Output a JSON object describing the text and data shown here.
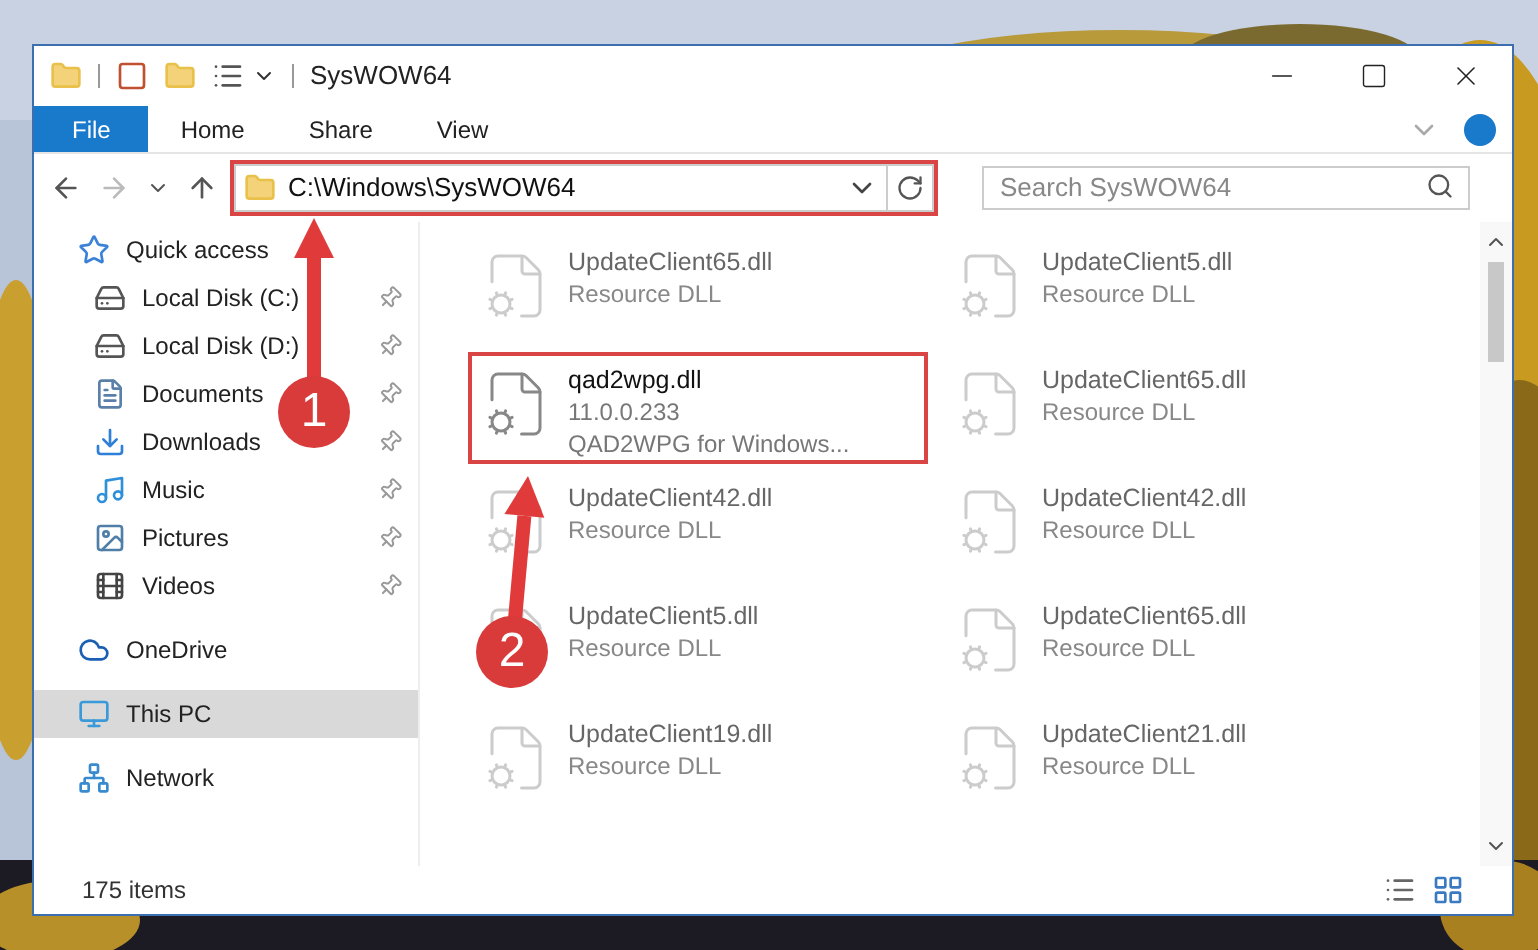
{
  "window": {
    "title": "SysWOW64"
  },
  "ribbon_tabs": [
    {
      "label": "File",
      "kind": "file"
    },
    {
      "label": "Home",
      "kind": "tab"
    },
    {
      "label": "Share",
      "kind": "tab"
    },
    {
      "label": "View",
      "kind": "tab"
    }
  ],
  "address": {
    "path": "C:\\Windows\\SysWOW64"
  },
  "search": {
    "placeholder": "Search SysWOW64"
  },
  "sidebar": {
    "items": [
      {
        "label": "Quick access",
        "selected": false,
        "children": [
          {
            "label": "Local Disk (C:)",
            "pinned": true,
            "selected": false
          },
          {
            "label": "Local Disk (D:)",
            "pinned": true,
            "selected": false
          },
          {
            "label": "Documents",
            "pinned": true,
            "selected": false
          },
          {
            "label": "Downloads",
            "pinned": true,
            "selected": false
          },
          {
            "label": "Music",
            "pinned": true,
            "selected": false
          },
          {
            "label": "Pictures",
            "pinned": true,
            "selected": false
          },
          {
            "label": "Videos",
            "pinned": true,
            "selected": false
          }
        ]
      },
      {
        "label": "OneDrive",
        "selected": false
      },
      {
        "label": "This PC",
        "selected": true
      },
      {
        "label": "Network",
        "selected": false
      }
    ]
  },
  "files": [
    {
      "name": "UpdateClient65.dll",
      "details": [
        "Resource DLL"
      ],
      "highlighted": false
    },
    {
      "name": "UpdateClient5.dll",
      "details": [
        "Resource DLL"
      ],
      "highlighted": false
    },
    {
      "name": "qad2wpg.dll",
      "details": [
        "11.0.0.233",
        "QAD2WPG for Windows..."
      ],
      "highlighted": true
    },
    {
      "name": "UpdateClient65.dll",
      "details": [
        "Resource DLL"
      ],
      "highlighted": false
    },
    {
      "name": "UpdateClient42.dll",
      "details": [
        "Resource DLL"
      ],
      "highlighted": false
    },
    {
      "name": "UpdateClient42.dll",
      "details": [
        "Resource DLL"
      ],
      "highlighted": false
    },
    {
      "name": "UpdateClient5.dll",
      "details": [
        "Resource DLL"
      ],
      "highlighted": false
    },
    {
      "name": "UpdateClient65.dll",
      "details": [
        "Resource DLL"
      ],
      "highlighted": false
    },
    {
      "name": "UpdateClient19.dll",
      "details": [
        "Resource DLL"
      ],
      "highlighted": false
    },
    {
      "name": "UpdateClient21.dll",
      "details": [
        "Resource DLL"
      ],
      "highlighted": false
    }
  ],
  "annotations": [
    {
      "label": "1"
    },
    {
      "label": "2"
    }
  ],
  "status_bar": {
    "count": "175 items"
  }
}
